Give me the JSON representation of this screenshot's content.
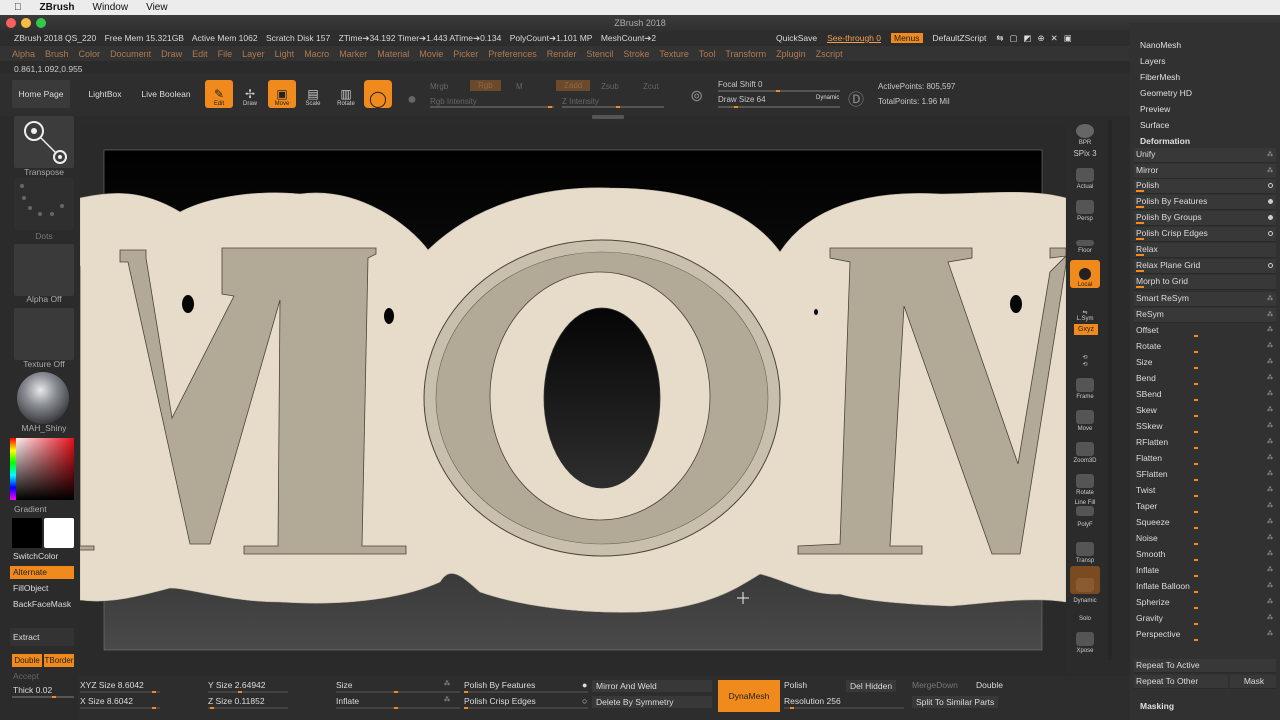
{
  "mac_menu": {
    "app": "ZBrush",
    "items": [
      "Window",
      "View"
    ]
  },
  "window_title": "ZBrush 2018",
  "infobar": {
    "version": "ZBrush 2018 QS_220",
    "free_mem": "Free Mem 15.321GB",
    "active_mem": "Active Mem 1062",
    "scratch": "Scratch Disk 157",
    "ztime": "ZTime➔34.192 Timer➔1.443 ATime➔0.134",
    "polycount": "PolyCount➔1.101 MP",
    "meshcount": "MeshCount➔2"
  },
  "quickbar": {
    "quicksave": "QuickSave",
    "seethrough": "See-through  0",
    "menus": "Menus",
    "script": "DefaultZScript"
  },
  "menus": [
    "Alpha",
    "Brush",
    "Color",
    "Document",
    "Draw",
    "Edit",
    "File",
    "Layer",
    "Light",
    "Macro",
    "Marker",
    "Material",
    "Movie",
    "Picker",
    "Preferences",
    "Render",
    "Stencil",
    "Stroke",
    "Texture",
    "Tool",
    "Transform",
    "Zplugin",
    "Zscript"
  ],
  "coords": "0.861,1.092,0.955",
  "shelf": {
    "home": "Home Page",
    "lightbox": "LightBox",
    "liveboolean": "Live Boolean",
    "edit": "Edit",
    "draw": "Draw",
    "move": "Move",
    "scale": "Scale",
    "rotate": "Rotate",
    "mrgb": "Mrgb",
    "rgb": "Rgb",
    "m": "M",
    "rgb_intensity": "Rgb Intensity",
    "zadd": "Zadd",
    "zsub": "Zsub",
    "zcut": "Zcut",
    "z_intensity": "Z Intensity",
    "focal": "Focal Shift 0",
    "drawsize": "Draw Size 64",
    "dynamic": "Dynamic",
    "active_points": "ActivePoints: 805,597",
    "total_points": "TotalPoints: 1.96 Mil"
  },
  "left": {
    "transpose": "Transpose",
    "dots": "Dots",
    "alpha": "Alpha Off",
    "texture": "Texture Off",
    "material": "MAH_Shiny",
    "gradient": "Gradient",
    "switchcolor": "SwitchColor",
    "alternate": "Alternate",
    "fillobject": "FillObject",
    "backface": "BackFaceMask",
    "extract": "Extract",
    "double": "Double",
    "tborder": "TBorder",
    "accept": "Accept",
    "thick": "Thick 0.02"
  },
  "rightcol": {
    "bpr": "BPR",
    "spix": "SPix 3",
    "actual": "Actual",
    "persp": "Persp",
    "floor": "Floor",
    "local": "Local",
    "lsym": "L.Sym",
    "gxyz": "Gxyz",
    "frame": "Frame",
    "move": "Move",
    "zoom3d": "Zoom3D",
    "rotate": "Rotate",
    "linefill": "Line Fill",
    "polyf": "PolyF",
    "transp": "Transp",
    "dynamic": "Dynamic",
    "solo": "Solo",
    "xpose": "Xpose"
  },
  "rightpanel": {
    "headers": [
      "NanoMesh",
      "Layers",
      "FiberMesh",
      "Geometry HD",
      "Preview",
      "Surface",
      "Deformation"
    ],
    "items": [
      "Unify",
      "Mirror",
      "Polish",
      "Polish By Features",
      "Polish By Groups",
      "Polish Crisp Edges",
      "Relax",
      "Relax Plane Grid",
      "Morph to Grid",
      "Smart ReSym",
      "ReSym"
    ],
    "sliders": [
      "Offset",
      "Rotate",
      "Size",
      "Bend",
      "SBend",
      "Skew",
      "SSkew",
      "RFlatten",
      "Flatten",
      "SFlatten",
      "Twist",
      "Taper",
      "Squeeze",
      "Noise",
      "Smooth",
      "Inflate",
      "Inflate Balloon",
      "Spherize",
      "Gravity",
      "Perspective"
    ],
    "repeat_active": "Repeat To Active",
    "repeat_other": "Repeat To Other",
    "mask": "Mask",
    "masking": "Masking"
  },
  "bottom": {
    "xyz_size": "XYZ Size 8.6042",
    "y_size": "Y Size 2.64942",
    "x_size": "X Size 8.6042",
    "z_size": "Z Size 0.11852",
    "size": "Size",
    "inflate": "Inflate",
    "polish_features": "Polish By Features",
    "polish_crisp": "Polish Crisp Edges",
    "mirror_weld": "Mirror And Weld",
    "delete_sym": "Delete By Symmetry",
    "dynamesh": "DynaMesh",
    "polish": "Polish",
    "resolution": "Resolution 256",
    "delhidden": "Del Hidden",
    "mergedown": "MergeDown",
    "double": "Double",
    "split": "Split To Similar Parts"
  },
  "colors": {
    "accent": "#f08a1c",
    "panel": "#313131",
    "canvas": "#434343",
    "cream": "#e6dcc9",
    "letter": "#b3a997"
  }
}
